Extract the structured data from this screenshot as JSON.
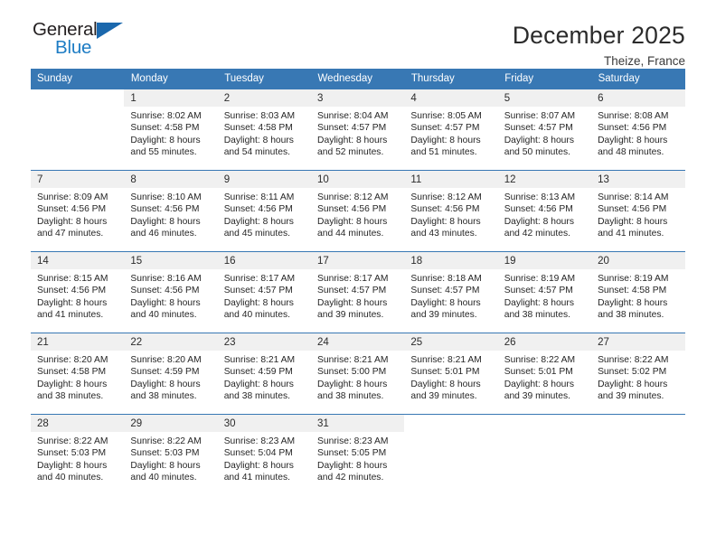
{
  "brand": {
    "name_top": "General",
    "name_bottom": "Blue",
    "accent_color": "#1d7cc4",
    "triangle_color": "#1b68ad"
  },
  "header": {
    "title": "December 2025",
    "location": "Theize, France",
    "header_bg": "#3878b4"
  },
  "weekday_headers": [
    "Sunday",
    "Monday",
    "Tuesday",
    "Wednesday",
    "Thursday",
    "Friday",
    "Saturday"
  ],
  "weeks": [
    [
      {
        "day": "",
        "sunrise": "",
        "sunset": "",
        "daylight_line1": "",
        "daylight_line2": ""
      },
      {
        "day": "1",
        "sunrise": "Sunrise: 8:02 AM",
        "sunset": "Sunset: 4:58 PM",
        "daylight_line1": "Daylight: 8 hours",
        "daylight_line2": "and 55 minutes."
      },
      {
        "day": "2",
        "sunrise": "Sunrise: 8:03 AM",
        "sunset": "Sunset: 4:58 PM",
        "daylight_line1": "Daylight: 8 hours",
        "daylight_line2": "and 54 minutes."
      },
      {
        "day": "3",
        "sunrise": "Sunrise: 8:04 AM",
        "sunset": "Sunset: 4:57 PM",
        "daylight_line1": "Daylight: 8 hours",
        "daylight_line2": "and 52 minutes."
      },
      {
        "day": "4",
        "sunrise": "Sunrise: 8:05 AM",
        "sunset": "Sunset: 4:57 PM",
        "daylight_line1": "Daylight: 8 hours",
        "daylight_line2": "and 51 minutes."
      },
      {
        "day": "5",
        "sunrise": "Sunrise: 8:07 AM",
        "sunset": "Sunset: 4:57 PM",
        "daylight_line1": "Daylight: 8 hours",
        "daylight_line2": "and 50 minutes."
      },
      {
        "day": "6",
        "sunrise": "Sunrise: 8:08 AM",
        "sunset": "Sunset: 4:56 PM",
        "daylight_line1": "Daylight: 8 hours",
        "daylight_line2": "and 48 minutes."
      }
    ],
    [
      {
        "day": "7",
        "sunrise": "Sunrise: 8:09 AM",
        "sunset": "Sunset: 4:56 PM",
        "daylight_line1": "Daylight: 8 hours",
        "daylight_line2": "and 47 minutes."
      },
      {
        "day": "8",
        "sunrise": "Sunrise: 8:10 AM",
        "sunset": "Sunset: 4:56 PM",
        "daylight_line1": "Daylight: 8 hours",
        "daylight_line2": "and 46 minutes."
      },
      {
        "day": "9",
        "sunrise": "Sunrise: 8:11 AM",
        "sunset": "Sunset: 4:56 PM",
        "daylight_line1": "Daylight: 8 hours",
        "daylight_line2": "and 45 minutes."
      },
      {
        "day": "10",
        "sunrise": "Sunrise: 8:12 AM",
        "sunset": "Sunset: 4:56 PM",
        "daylight_line1": "Daylight: 8 hours",
        "daylight_line2": "and 44 minutes."
      },
      {
        "day": "11",
        "sunrise": "Sunrise: 8:12 AM",
        "sunset": "Sunset: 4:56 PM",
        "daylight_line1": "Daylight: 8 hours",
        "daylight_line2": "and 43 minutes."
      },
      {
        "day": "12",
        "sunrise": "Sunrise: 8:13 AM",
        "sunset": "Sunset: 4:56 PM",
        "daylight_line1": "Daylight: 8 hours",
        "daylight_line2": "and 42 minutes."
      },
      {
        "day": "13",
        "sunrise": "Sunrise: 8:14 AM",
        "sunset": "Sunset: 4:56 PM",
        "daylight_line1": "Daylight: 8 hours",
        "daylight_line2": "and 41 minutes."
      }
    ],
    [
      {
        "day": "14",
        "sunrise": "Sunrise: 8:15 AM",
        "sunset": "Sunset: 4:56 PM",
        "daylight_line1": "Daylight: 8 hours",
        "daylight_line2": "and 41 minutes."
      },
      {
        "day": "15",
        "sunrise": "Sunrise: 8:16 AM",
        "sunset": "Sunset: 4:56 PM",
        "daylight_line1": "Daylight: 8 hours",
        "daylight_line2": "and 40 minutes."
      },
      {
        "day": "16",
        "sunrise": "Sunrise: 8:17 AM",
        "sunset": "Sunset: 4:57 PM",
        "daylight_line1": "Daylight: 8 hours",
        "daylight_line2": "and 40 minutes."
      },
      {
        "day": "17",
        "sunrise": "Sunrise: 8:17 AM",
        "sunset": "Sunset: 4:57 PM",
        "daylight_line1": "Daylight: 8 hours",
        "daylight_line2": "and 39 minutes."
      },
      {
        "day": "18",
        "sunrise": "Sunrise: 8:18 AM",
        "sunset": "Sunset: 4:57 PM",
        "daylight_line1": "Daylight: 8 hours",
        "daylight_line2": "and 39 minutes."
      },
      {
        "day": "19",
        "sunrise": "Sunrise: 8:19 AM",
        "sunset": "Sunset: 4:57 PM",
        "daylight_line1": "Daylight: 8 hours",
        "daylight_line2": "and 38 minutes."
      },
      {
        "day": "20",
        "sunrise": "Sunrise: 8:19 AM",
        "sunset": "Sunset: 4:58 PM",
        "daylight_line1": "Daylight: 8 hours",
        "daylight_line2": "and 38 minutes."
      }
    ],
    [
      {
        "day": "21",
        "sunrise": "Sunrise: 8:20 AM",
        "sunset": "Sunset: 4:58 PM",
        "daylight_line1": "Daylight: 8 hours",
        "daylight_line2": "and 38 minutes."
      },
      {
        "day": "22",
        "sunrise": "Sunrise: 8:20 AM",
        "sunset": "Sunset: 4:59 PM",
        "daylight_line1": "Daylight: 8 hours",
        "daylight_line2": "and 38 minutes."
      },
      {
        "day": "23",
        "sunrise": "Sunrise: 8:21 AM",
        "sunset": "Sunset: 4:59 PM",
        "daylight_line1": "Daylight: 8 hours",
        "daylight_line2": "and 38 minutes."
      },
      {
        "day": "24",
        "sunrise": "Sunrise: 8:21 AM",
        "sunset": "Sunset: 5:00 PM",
        "daylight_line1": "Daylight: 8 hours",
        "daylight_line2": "and 38 minutes."
      },
      {
        "day": "25",
        "sunrise": "Sunrise: 8:21 AM",
        "sunset": "Sunset: 5:01 PM",
        "daylight_line1": "Daylight: 8 hours",
        "daylight_line2": "and 39 minutes."
      },
      {
        "day": "26",
        "sunrise": "Sunrise: 8:22 AM",
        "sunset": "Sunset: 5:01 PM",
        "daylight_line1": "Daylight: 8 hours",
        "daylight_line2": "and 39 minutes."
      },
      {
        "day": "27",
        "sunrise": "Sunrise: 8:22 AM",
        "sunset": "Sunset: 5:02 PM",
        "daylight_line1": "Daylight: 8 hours",
        "daylight_line2": "and 39 minutes."
      }
    ],
    [
      {
        "day": "28",
        "sunrise": "Sunrise: 8:22 AM",
        "sunset": "Sunset: 5:03 PM",
        "daylight_line1": "Daylight: 8 hours",
        "daylight_line2": "and 40 minutes."
      },
      {
        "day": "29",
        "sunrise": "Sunrise: 8:22 AM",
        "sunset": "Sunset: 5:03 PM",
        "daylight_line1": "Daylight: 8 hours",
        "daylight_line2": "and 40 minutes."
      },
      {
        "day": "30",
        "sunrise": "Sunrise: 8:23 AM",
        "sunset": "Sunset: 5:04 PM",
        "daylight_line1": "Daylight: 8 hours",
        "daylight_line2": "and 41 minutes."
      },
      {
        "day": "31",
        "sunrise": "Sunrise: 8:23 AM",
        "sunset": "Sunset: 5:05 PM",
        "daylight_line1": "Daylight: 8 hours",
        "daylight_line2": "and 42 minutes."
      },
      {
        "day": "",
        "sunrise": "",
        "sunset": "",
        "daylight_line1": "",
        "daylight_line2": ""
      },
      {
        "day": "",
        "sunrise": "",
        "sunset": "",
        "daylight_line1": "",
        "daylight_line2": ""
      },
      {
        "day": "",
        "sunrise": "",
        "sunset": "",
        "daylight_line1": "",
        "daylight_line2": ""
      }
    ]
  ]
}
